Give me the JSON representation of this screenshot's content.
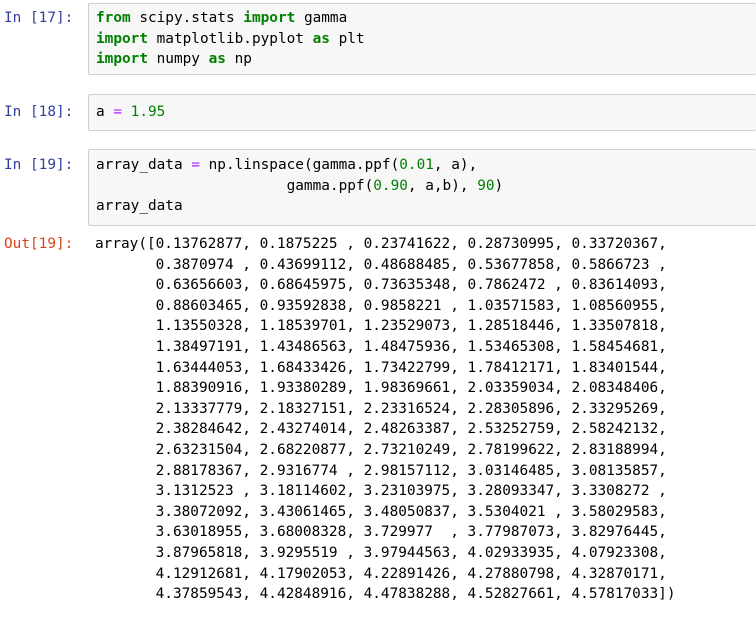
{
  "cells": [
    {
      "prompt": "In [17]:",
      "type": "input",
      "lines": [
        [
          {
            "t": "from",
            "c": "kw"
          },
          {
            "t": " scipy.stats ",
            "c": ""
          },
          {
            "t": "import",
            "c": "kw"
          },
          {
            "t": " gamma",
            "c": ""
          }
        ],
        [
          {
            "t": "import",
            "c": "kw"
          },
          {
            "t": " matplotlib.pyplot ",
            "c": ""
          },
          {
            "t": "as",
            "c": "kw"
          },
          {
            "t": " plt",
            "c": ""
          }
        ],
        [
          {
            "t": "import",
            "c": "kw"
          },
          {
            "t": " numpy ",
            "c": ""
          },
          {
            "t": "as",
            "c": "kw"
          },
          {
            "t": " np",
            "c": ""
          }
        ]
      ]
    },
    {
      "prompt": "In [18]:",
      "type": "input",
      "lines": [
        [
          {
            "t": "a ",
            "c": ""
          },
          {
            "t": "=",
            "c": "eq"
          },
          {
            "t": " ",
            "c": ""
          },
          {
            "t": "1.95",
            "c": "num"
          }
        ]
      ]
    },
    {
      "prompt": "In [19]:",
      "type": "input",
      "lines": [
        [
          {
            "t": "array_data ",
            "c": ""
          },
          {
            "t": "=",
            "c": "eq"
          },
          {
            "t": " np.linspace(gamma.ppf(",
            "c": ""
          },
          {
            "t": "0.01",
            "c": "num"
          },
          {
            "t": ", a),",
            "c": ""
          }
        ],
        [
          {
            "t": "                      gamma.ppf(",
            "c": ""
          },
          {
            "t": "0.90",
            "c": "num"
          },
          {
            "t": ", a,b), ",
            "c": ""
          },
          {
            "t": "90",
            "c": "num"
          },
          {
            "t": ")",
            "c": ""
          }
        ],
        [
          {
            "t": "array_data",
            "c": ""
          }
        ]
      ]
    }
  ],
  "output": {
    "prompt": "Out[19]:",
    "lines": [
      "array([0.13762877, 0.1875225 , 0.23741622, 0.28730995, 0.33720367,",
      "       0.3870974 , 0.43699112, 0.48688485, 0.53677858, 0.5866723 ,",
      "       0.63656603, 0.68645975, 0.73635348, 0.7862472 , 0.83614093,",
      "       0.88603465, 0.93592838, 0.9858221 , 1.03571583, 1.08560955,",
      "       1.13550328, 1.18539701, 1.23529073, 1.28518446, 1.33507818,",
      "       1.38497191, 1.43486563, 1.48475936, 1.53465308, 1.58454681,",
      "       1.63444053, 1.68433426, 1.73422799, 1.78412171, 1.83401544,",
      "       1.88390916, 1.93380289, 1.98369661, 2.03359034, 2.08348406,",
      "       2.13337779, 2.18327151, 2.23316524, 2.28305896, 2.33295269,",
      "       2.38284642, 2.43274014, 2.48263387, 2.53252759, 2.58242132,",
      "       2.63231504, 2.68220877, 2.73210249, 2.78199622, 2.83188994,",
      "       2.88178367, 2.9316774 , 2.98157112, 3.03146485, 3.08135857,",
      "       3.1312523 , 3.18114602, 3.23103975, 3.28093347, 3.3308272 ,",
      "       3.38072092, 3.43061465, 3.48050837, 3.5304021 , 3.58029583,",
      "       3.63018955, 3.68008328, 3.729977  , 3.77987073, 3.82976445,",
      "       3.87965818, 3.9295519 , 3.97944563, 4.02933935, 4.07923308,",
      "       4.12912681, 4.17902053, 4.22891426, 4.27880798, 4.32870171,",
      "       4.37859543, 4.42848916, 4.47838288, 4.52827661, 4.57817033])"
    ]
  }
}
